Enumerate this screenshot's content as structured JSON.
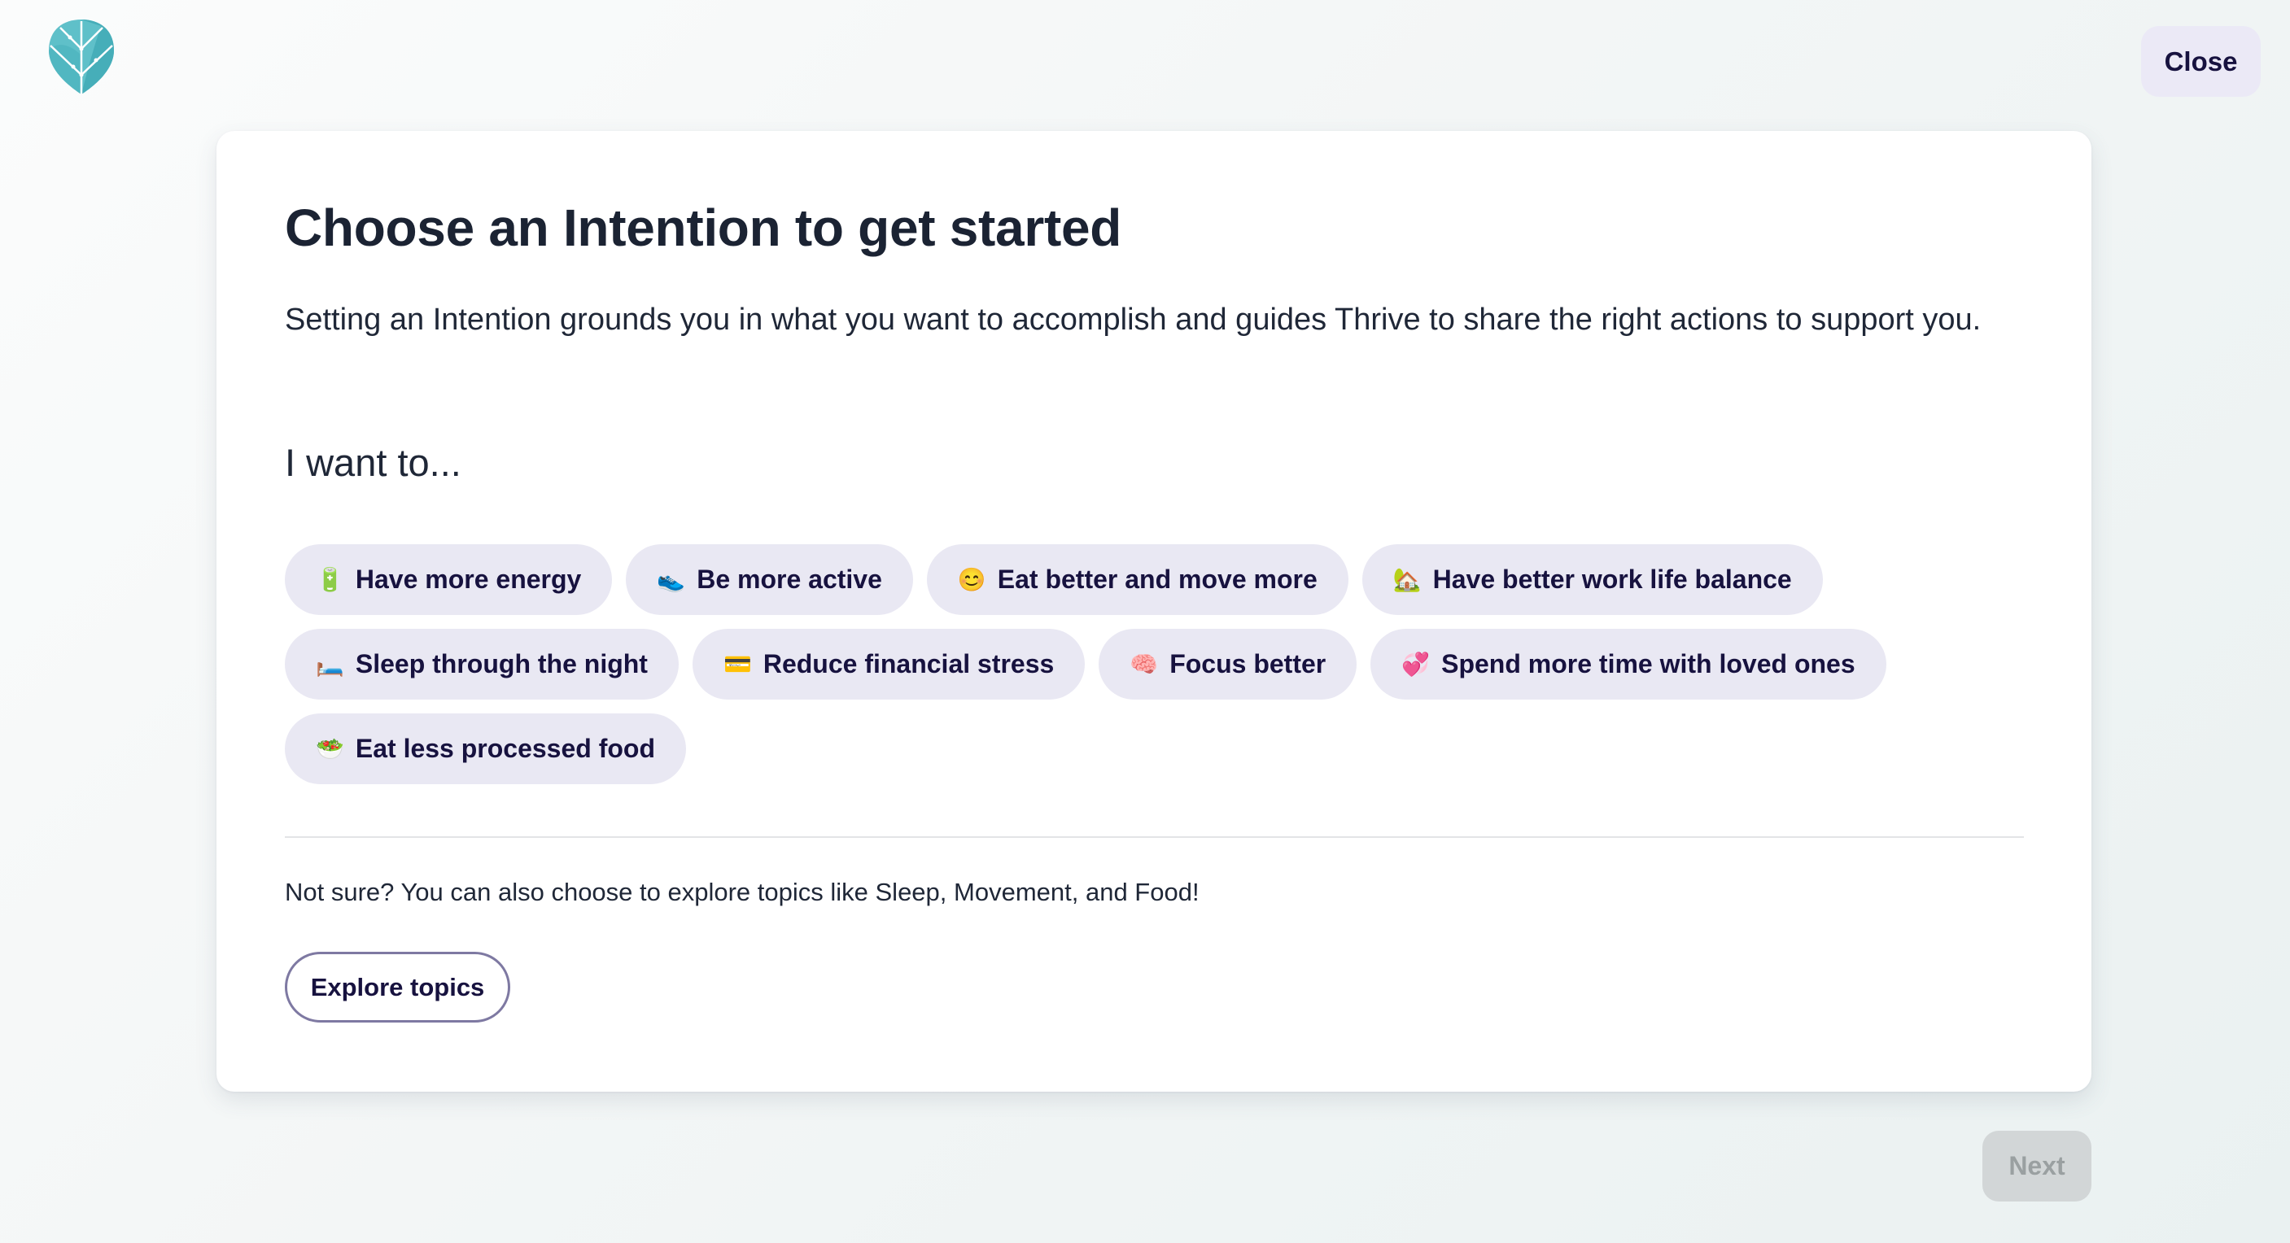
{
  "header": {
    "logo": "thrive-leaf-logo",
    "close_label": "Close"
  },
  "card": {
    "title": "Choose an Intention to get started",
    "description": "Setting an Intention grounds you in what you want to accomplish and guides Thrive to share the right actions to support you.",
    "prompt": "I want to...",
    "intentions": [
      {
        "emoji": "🔋",
        "icon": "battery-icon",
        "label": "Have more energy"
      },
      {
        "emoji": "👟",
        "icon": "sneaker-icon",
        "label": "Be more active"
      },
      {
        "emoji": "😊",
        "icon": "smiling-face-icon",
        "label": "Eat better and move more"
      },
      {
        "emoji": "🏡",
        "icon": "house-with-garden-icon",
        "label": "Have better work life balance"
      },
      {
        "emoji": "🛏️",
        "icon": "bed-icon",
        "label": "Sleep through the night"
      },
      {
        "emoji": "💳",
        "icon": "credit-card-icon",
        "label": "Reduce financial stress"
      },
      {
        "emoji": "🧠",
        "icon": "brain-icon",
        "label": "Focus better"
      },
      {
        "emoji": "💞",
        "icon": "revolving-hearts-icon",
        "label": "Spend more time with loved ones"
      },
      {
        "emoji": "🥗",
        "icon": "salad-icon",
        "label": "Eat less processed food"
      }
    ],
    "not_sure_text": "Not sure? You can also choose to explore topics like Sleep, Movement, and Food!",
    "explore_label": "Explore topics"
  },
  "footer": {
    "next_label": "Next",
    "next_disabled": true
  },
  "colors": {
    "brand_teal": "#4fb8c4",
    "chip_bg": "#e9e8f3",
    "text_primary": "#17123f",
    "disabled_bg": "#d2d6d7"
  }
}
